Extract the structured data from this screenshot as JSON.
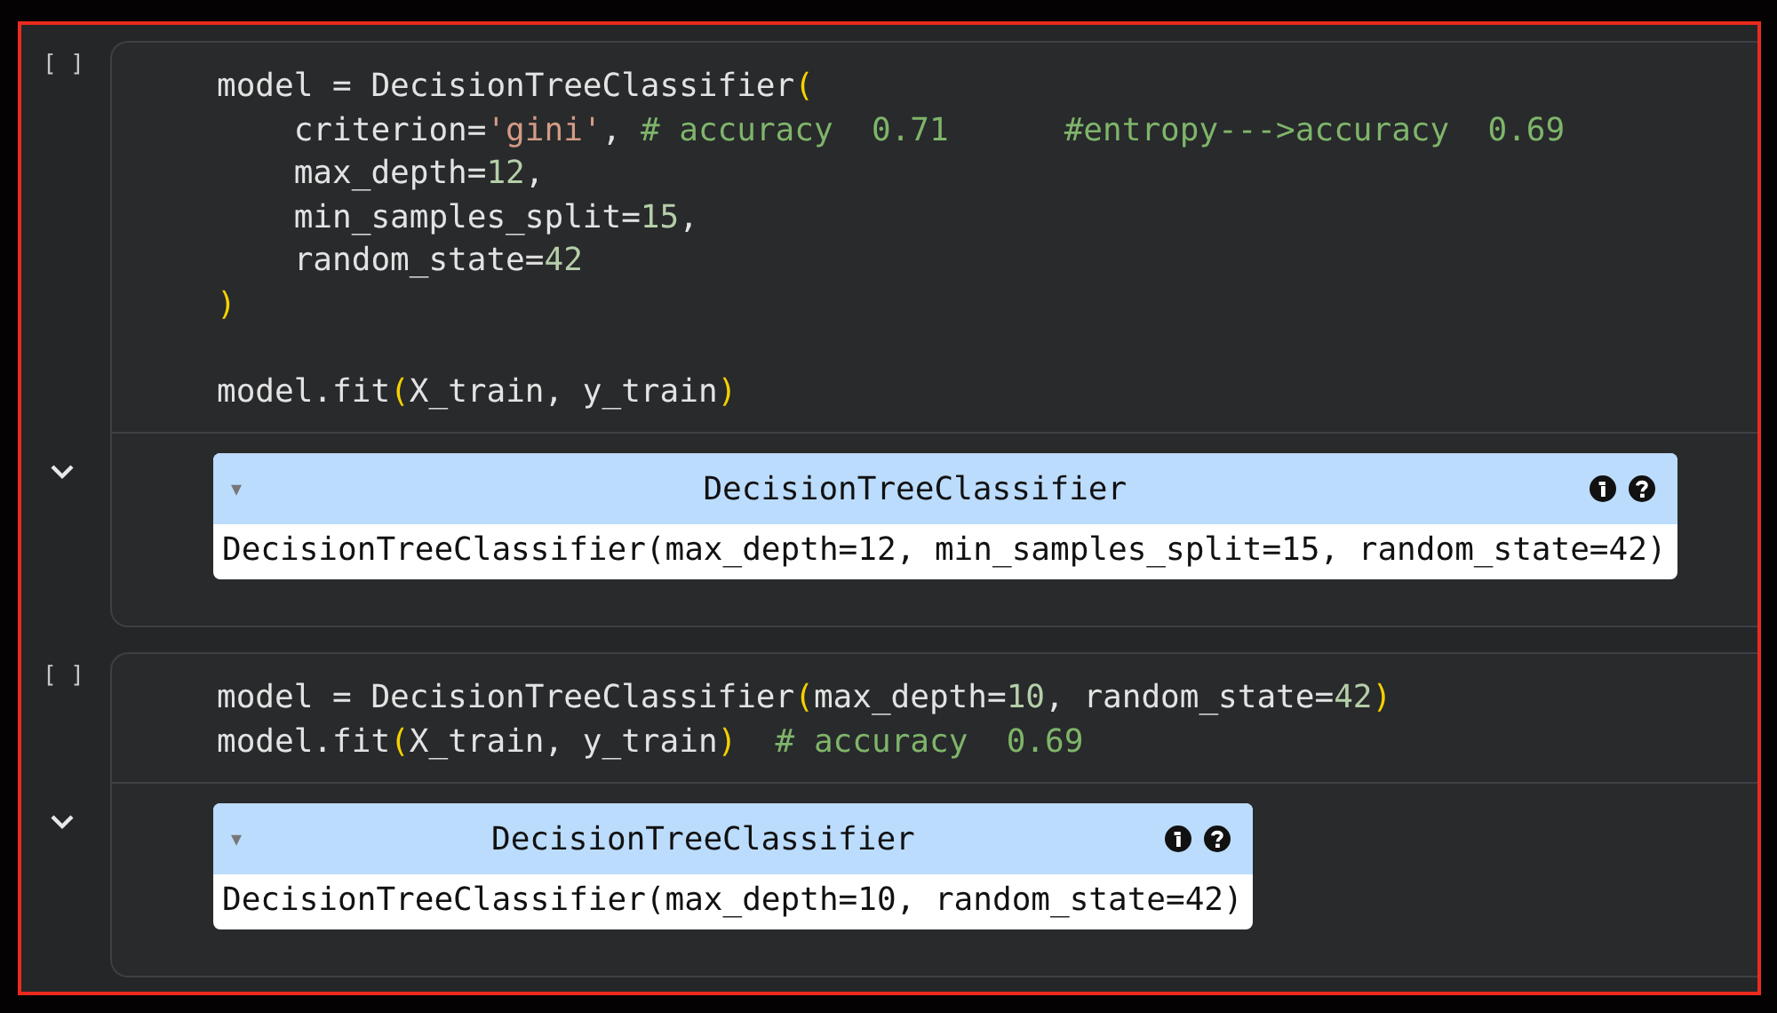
{
  "cells": [
    {
      "prompt": "[ ]",
      "code": [
        {
          "kind": "code",
          "tokens": [
            {
              "kind": "plain",
              "text": "model = DecisionTreeClassifier"
            },
            {
              "kind": "paren",
              "text": "("
            }
          ]
        },
        {
          "kind": "code",
          "tokens": [
            {
              "kind": "plain",
              "text": "    criterion="
            },
            {
              "kind": "string",
              "text": "'gini'"
            },
            {
              "kind": "plain",
              "text": ", "
            },
            {
              "kind": "comment",
              "text": "# accuracy  0.71      #entropy--->accuracy  0.69"
            }
          ]
        },
        {
          "kind": "code",
          "tokens": [
            {
              "kind": "plain",
              "text": "    max_depth="
            },
            {
              "kind": "number",
              "text": "12"
            },
            {
              "kind": "plain",
              "text": ","
            }
          ]
        },
        {
          "kind": "code",
          "tokens": [
            {
              "kind": "plain",
              "text": "    min_samples_split="
            },
            {
              "kind": "number",
              "text": "15"
            },
            {
              "kind": "plain",
              "text": ","
            }
          ]
        },
        {
          "kind": "code",
          "tokens": [
            {
              "kind": "plain",
              "text": "    random_state="
            },
            {
              "kind": "number",
              "text": "42"
            }
          ]
        },
        {
          "kind": "code",
          "tokens": [
            {
              "kind": "paren",
              "text": ")"
            }
          ]
        },
        {
          "kind": "blank"
        },
        {
          "kind": "code",
          "tokens": [
            {
              "kind": "plain",
              "text": "model.fit"
            },
            {
              "kind": "paren",
              "text": "("
            },
            {
              "kind": "plain",
              "text": "X_train, y_train"
            },
            {
              "kind": "paren",
              "text": ")"
            }
          ]
        }
      ],
      "output": {
        "toggle": "▾",
        "title": "DecisionTreeClassifier",
        "repr": "DecisionTreeClassifier(max_depth=12, min_samples_split=15, random_state=42)"
      }
    },
    {
      "prompt": "[ ]",
      "code": [
        {
          "kind": "code",
          "tokens": [
            {
              "kind": "plain",
              "text": "model = DecisionTreeClassifier"
            },
            {
              "kind": "paren",
              "text": "("
            },
            {
              "kind": "plain",
              "text": "max_depth="
            },
            {
              "kind": "number",
              "text": "10"
            },
            {
              "kind": "plain",
              "text": ", random_state="
            },
            {
              "kind": "number",
              "text": "42"
            },
            {
              "kind": "paren",
              "text": ")"
            }
          ]
        },
        {
          "kind": "code",
          "tokens": [
            {
              "kind": "plain",
              "text": "model.fit"
            },
            {
              "kind": "paren",
              "text": "("
            },
            {
              "kind": "plain",
              "text": "X_train, y_train"
            },
            {
              "kind": "paren",
              "text": ")"
            },
            {
              "kind": "comment",
              "text": "  # accuracy  0.69"
            }
          ]
        }
      ],
      "output": {
        "toggle": "▾",
        "title": "DecisionTreeClassifier",
        "repr": "DecisionTreeClassifier(max_depth=10, random_state=42)"
      }
    }
  ]
}
